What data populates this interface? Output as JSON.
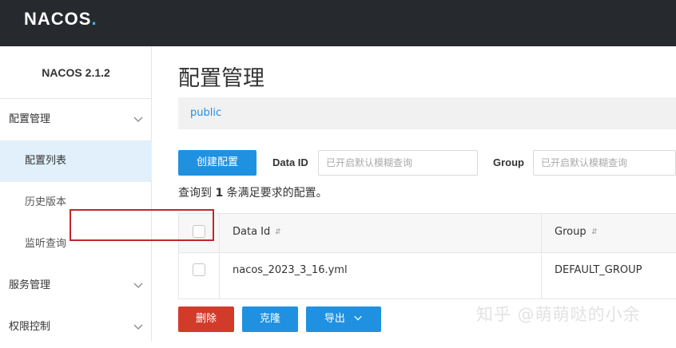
{
  "header": {
    "logo_text": "NACOS",
    "logo_suffix": "."
  },
  "sidebar": {
    "version": "NACOS 2.1.2",
    "groups": [
      {
        "label": "配置管理",
        "items": [
          "配置列表",
          "历史版本",
          "监听查询"
        ],
        "active_item": "配置列表"
      },
      {
        "label": "服务管理"
      },
      {
        "label": "权限控制"
      }
    ]
  },
  "main": {
    "title": "配置管理",
    "namespace": "public",
    "create_button": "创建配置",
    "filters": {
      "data_id_label": "Data ID",
      "data_id_placeholder": "已开启默认模糊查询",
      "group_label": "Group",
      "group_placeholder": "已开启默认模糊查询"
    },
    "result": {
      "prefix": "查询到",
      "count": "1",
      "suffix": "条满足要求的配置。"
    },
    "table": {
      "columns": [
        "Data Id",
        "Group"
      ],
      "rows": [
        {
          "data_id": "nacos_2023_3_16.yml",
          "group": "DEFAULT_GROUP"
        }
      ]
    },
    "actions": {
      "delete": "删除",
      "clone": "克隆",
      "export": "导出"
    }
  },
  "watermark": "知乎 @萌萌哒的小余",
  "colors": {
    "primary": "#2091e0",
    "danger": "#d23b2a",
    "topbar": "#262a2f",
    "active_menu_bg": "#e1f0fb",
    "highlight": "#c0272d"
  }
}
